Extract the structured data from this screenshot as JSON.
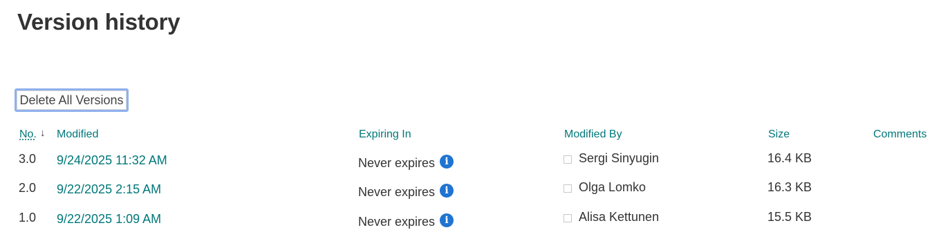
{
  "page": {
    "title": "Version history"
  },
  "toolbar": {
    "delete_all_label": "Delete All Versions"
  },
  "table": {
    "columns": {
      "no": "No.",
      "modified": "Modified",
      "expiring": "Expiring In",
      "modified_by": "Modified By",
      "size": "Size",
      "comments": "Comments"
    },
    "sort_indicator": "↓",
    "rows": [
      {
        "no": "3.0",
        "modified": "9/24/2025 11:32 AM",
        "expiring": "Never expires",
        "modified_by": "Sergi Sinyugin",
        "size": "16.4 KB",
        "comments": ""
      },
      {
        "no": "2.0",
        "modified": "9/22/2025 2:15 AM",
        "expiring": "Never expires",
        "modified_by": "Olga Lomko",
        "size": "16.3 KB",
        "comments": ""
      },
      {
        "no": "1.0",
        "modified": "9/22/2025 1:09 AM",
        "expiring": "Never expires",
        "modified_by": "Alisa Kettunen",
        "size": "15.5 KB",
        "comments": ""
      }
    ]
  },
  "icons": {
    "info_glyph": "i",
    "info_icon_name": "info-icon",
    "presence_icon_name": "presence-checkbox-icon"
  },
  "colors": {
    "link": "#00777a",
    "info": "#1f74d2",
    "button_focus_border": "#8fb0ee",
    "text": "#333333"
  }
}
